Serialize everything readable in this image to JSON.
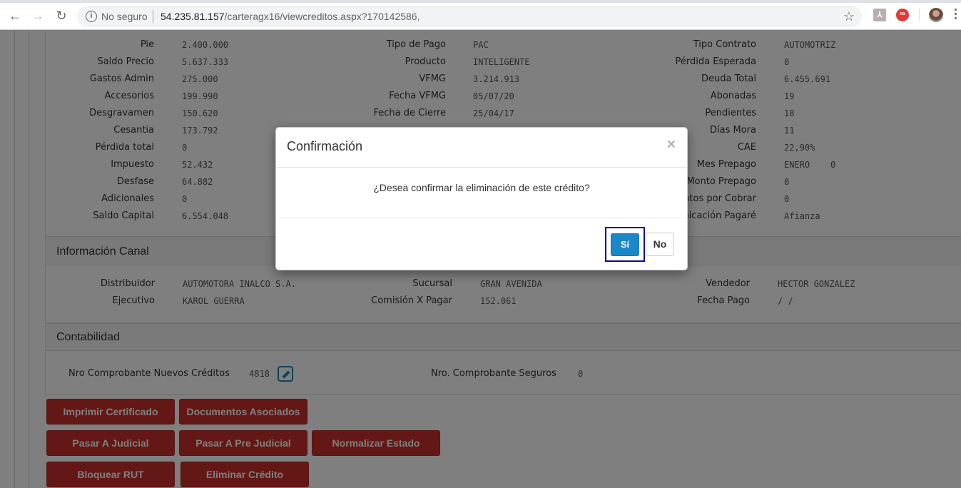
{
  "browser": {
    "security_label": "No seguro",
    "url_host": "54.235.81.157",
    "url_path": "/carteragx16/viewcreditos.aspx?170142586,",
    "ext_pdf": "⅄",
    "ext_red": "ᴷᴮ"
  },
  "credit_info": {
    "col1": [
      {
        "label": "Pie",
        "value": "2.400.000"
      },
      {
        "label": "Saldo Precio",
        "value": "5.637.333"
      },
      {
        "label": "Gastos Admin",
        "value": "275.000"
      },
      {
        "label": "Accesorios",
        "value": "199.990"
      },
      {
        "label": "Desgravamen",
        "value": "150.620"
      },
      {
        "label": "Cesantia",
        "value": "173.792"
      },
      {
        "label": "Pérdida total",
        "value": "0"
      },
      {
        "label": "Impuesto",
        "value": "52.432"
      },
      {
        "label": "Desfase",
        "value": "64.882"
      },
      {
        "label": "Adicionales",
        "value": "0"
      },
      {
        "label": "Saldo Capital",
        "value": "6.554.048"
      }
    ],
    "col2": [
      {
        "label": "Tipo de Pago",
        "value": "PAC"
      },
      {
        "label": "Producto",
        "value": "INTELIGENTE"
      },
      {
        "label": "VFMG",
        "value": "3.214.913"
      },
      {
        "label": "Fecha VFMG",
        "value": "05/07/20"
      },
      {
        "label": "Fecha de Cierre",
        "value": "25/04/17"
      }
    ],
    "col3": [
      {
        "label": "Tipo Contrato",
        "value": "AUTOMOTRIZ"
      },
      {
        "label": "Pérdida Esperada",
        "value": "0"
      },
      {
        "label": "Deuda Total",
        "value": "6.455.691"
      },
      {
        "label": "Abonadas",
        "value": "19"
      },
      {
        "label": "Pendientes",
        "value": "18"
      },
      {
        "label": "Días Mora",
        "value": "11"
      },
      {
        "label": "CAE",
        "value": "22,90%"
      },
      {
        "label": "Mes Prepago",
        "value": "ENERO",
        "extra": "0"
      },
      {
        "label": "Monto Prepago",
        "value": "0"
      },
      {
        "label": "ntos por Cobrar",
        "value": "0"
      },
      {
        "label": "bicación Pagaré",
        "value": "Afianza"
      }
    ]
  },
  "canal": {
    "title": "Información Canal",
    "distribuidor_label": "Distribuidor",
    "distribuidor_value": "AUTOMOTORA INALCO S.A.",
    "ejecutivo_label": "Ejecutivo",
    "ejecutivo_value": "KAROL GUERRA",
    "sucursal_label": "Sucursal",
    "sucursal_value": "GRAN AVENIDA",
    "comision_label": "Comisión X Pagar",
    "comision_value": "152.061",
    "vendedor_label": "Vendedor",
    "vendedor_value": "HECTOR GONZALEZ",
    "fecha_pago_label": "Fecha Pago",
    "fecha_pago_value": "/ /"
  },
  "contabilidad": {
    "title": "Contabilidad",
    "nro_creditos_label": "Nro Comprobante Nuevos Créditos",
    "nro_creditos_value": "4818",
    "nro_seguros_label": "Nro. Comprobante Seguros",
    "nro_seguros_value": "0"
  },
  "actions": {
    "imprimir": "Imprimir Certificado",
    "documentos": "Documentos Asociados",
    "judicial": "Pasar A Judicial",
    "pre_judicial": "Pasar A Pre Judicial",
    "normalizar": "Normalizar Estado",
    "bloquear": "Bloquear RUT",
    "eliminar": "Eliminar Crédito"
  },
  "modal": {
    "title": "Confirmación",
    "close": "×",
    "message": "¿Desea confirmar la eliminación de este crédito?",
    "yes": "Sí",
    "no": "No"
  }
}
